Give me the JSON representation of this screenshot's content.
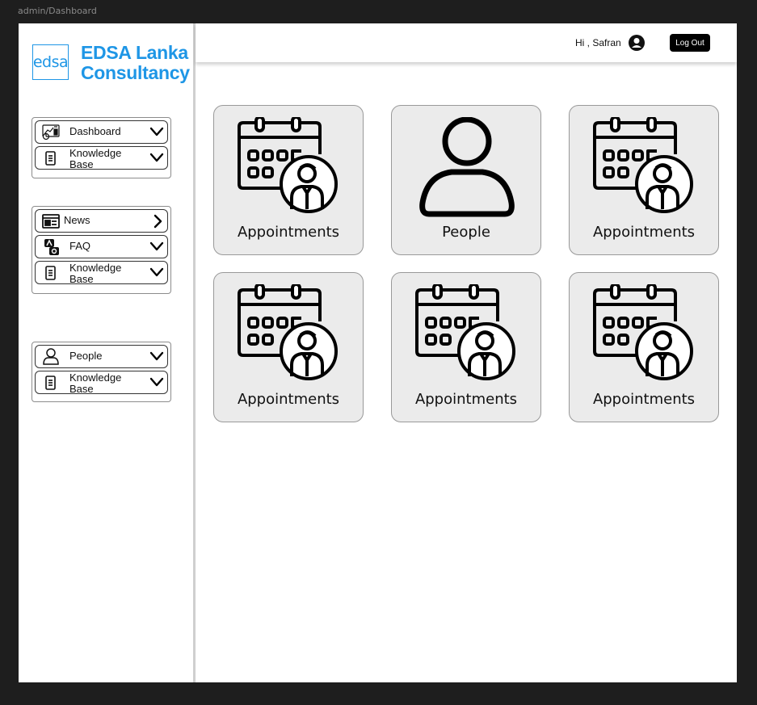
{
  "frame_label": "admin/Dashboard",
  "brand": {
    "logo_mark": "edsa",
    "name_line1": "EDSA Lanka",
    "name_line2": "Consultancy",
    "color": "#1e96e6"
  },
  "sidebar": {
    "group1": [
      {
        "label": "Dashboard",
        "icon": "dashboard-chart-icon"
      },
      {
        "label": "Knowledge",
        "label2": "Base",
        "icon": "document-icon"
      }
    ],
    "group2": [
      {
        "label": "News",
        "icon": "newspaper-icon"
      },
      {
        "label": "FAQ",
        "icon": "qa-icon"
      },
      {
        "label": "Knowledge",
        "label2": "Base",
        "icon": "document-icon"
      }
    ],
    "group3": [
      {
        "label": "People",
        "icon": "person-icon"
      },
      {
        "label": "Knowledge",
        "label2": "Base",
        "icon": "document-icon"
      }
    ]
  },
  "header": {
    "greeting": "Hi , Safran",
    "logout_label": "Log Out"
  },
  "cards": [
    {
      "label": "Appointments",
      "icon": "calendar-person-icon"
    },
    {
      "label": "People",
      "icon": "person-icon"
    },
    {
      "label": "Appointments",
      "icon": "calendar-person-icon"
    },
    {
      "label": "Appointments",
      "icon": "calendar-person-icon"
    },
    {
      "label": "Appointments",
      "icon": "calendar-person-icon"
    },
    {
      "label": "Appointments",
      "icon": "calendar-person-icon"
    }
  ]
}
